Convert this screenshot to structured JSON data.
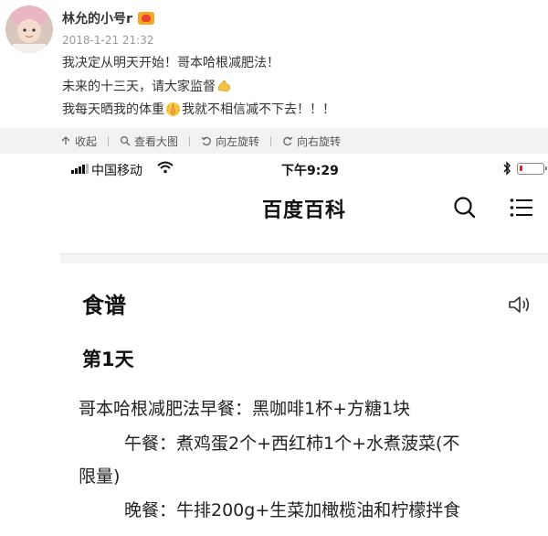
{
  "post": {
    "username": "林允的小号r",
    "timestamp": "2018-1-21 21:32",
    "line1": "我决定从明天开始！哥本哈根减肥法！",
    "line2_text": "未来的十三天，请大家监督",
    "line2_emoji": "flexed-biceps-emoji",
    "line3_before": "我每天晒我的体重",
    "line3_emoji": "praying-hands-emoji",
    "line3_after": "我就不相信减不下去！！！"
  },
  "toolbar": {
    "collapse": "收起",
    "view_large": "查看大图",
    "rotate_left": "向左旋转",
    "rotate_right": "向右旋转"
  },
  "phone": {
    "carrier": "中国移动",
    "time": "下午9:29",
    "app_title": "百度百科",
    "icons": [
      "signal-icon",
      "wifi-icon",
      "bluetooth-icon",
      "battery-icon",
      "search-icon",
      "menu-icon",
      "speaker-icon"
    ]
  },
  "recipe": {
    "heading": "食谱",
    "day": "第1天",
    "breakfast": "哥本哈根减肥法早餐：黑咖啡1杯+方糖1块",
    "lunch_line1": "午餐：煮鸡蛋2个+西红柿1个+水煮菠菜(不",
    "lunch_line2": "限量)",
    "dinner": "晚餐：牛排200g+生菜加橄榄油和柠檬拌食"
  },
  "colors": {
    "toolbar_bg": "#f2f2f5",
    "battery_low": "#e02020",
    "badge": "#f5a623"
  }
}
